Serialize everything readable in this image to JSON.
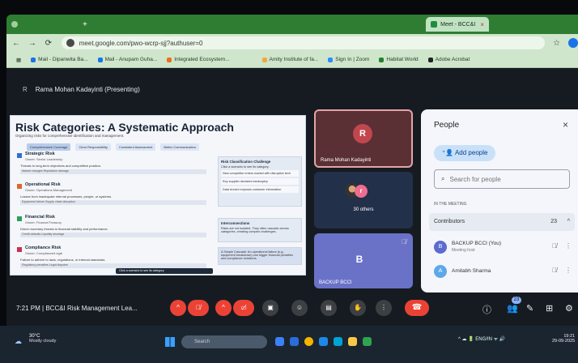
{
  "browser": {
    "tabs": [
      "",
      "",
      "",
      "",
      "",
      "Meet - BCC&I"
    ],
    "url": "meet.google.com/pwo-wcrp-sjj?authuser=0",
    "bookmarks": [
      "Mail - Dipanwita Ba...",
      "Mail - Anupam Guha...",
      "Integrated Ecosystem...",
      "",
      "Amity Institute of fa...",
      "Sign In | Zoom",
      "Habitat World",
      "Adobe Acrobat"
    ]
  },
  "meet": {
    "presenter_initial": "R",
    "presenter": "Rama Mohan Kadayinti (Presenting)",
    "time": "7:21 PM",
    "meeting_title": "BCC&I Risk Management Lea...",
    "slide": {
      "title": "Risk Categories: A Systematic Approach",
      "subtitle": "Organizing risks for comprehensive identification and management.",
      "tabs": [
        "Comprehensive Coverage",
        "Clear Responsibility",
        "Consistent Assessment",
        "Better Communication"
      ],
      "risks": [
        {
          "title": "Strategic Risk",
          "owner": "Owner: Senior Leadership",
          "desc": "Threats to long-term objectives and competitive position.",
          "bar": "Market changes   Reputation damage",
          "color": "#2f6fd0"
        },
        {
          "title": "Operational Risk",
          "owner": "Owner: Operations Management",
          "desc": "Losses from inadequate internal processes, people, or systems.",
          "bar": "Equipment failure   Supply chain disruption",
          "color": "#e0662a"
        },
        {
          "title": "Financial Risk",
          "owner": "Owner: Finance/Treasury",
          "desc": "Direct monetary threats to financial stability and performance.",
          "bar": "Credit defaults   Liquidity shortage",
          "color": "#2aa05a"
        },
        {
          "title": "Compliance Risk",
          "owner": "Owner: Compliance/Legal",
          "desc": "Failure to adhere to laws, regulations, or internal standards.",
          "bar": "Regulatory penalties   Legal disputes",
          "color": "#c83250"
        }
      ],
      "panel1": {
        "title": "Risk Classification Challenge",
        "lines": [
          "Click a scenario to see its category.",
          "New competitor enters market with disruptive tech",
          "Key supplier declares bankruptcy",
          "Data breach exposes customer information"
        ]
      },
      "panel2": {
        "title": "Interconnections",
        "lines": [
          "Risks are not isolated. They often cascade across categories, creating complex challenges."
        ]
      },
      "panel3": "A Simple Cascade: An operational failure (e.g., equipment breakdown) can trigger financial penalties and compliance violations.",
      "toast": "Click a scenario to see its category"
    },
    "tiles": [
      {
        "initial": "R",
        "name": "Rama Mohan Kadayinti"
      },
      {
        "initial": "r",
        "name": "30 others"
      },
      {
        "initial": "B",
        "name": "BACKUP BCCI"
      }
    ],
    "controls": [
      "^",
      "mic-off",
      "^",
      "cam-off",
      "present",
      "emoji",
      "captions",
      "hand",
      "more",
      "end"
    ],
    "people_count_badge": "23"
  },
  "people": {
    "title": "People",
    "add_label": "Add people",
    "search_placeholder": "Search for people",
    "in_meeting": "IN THE MEETING",
    "contributors_label": "Contributors",
    "contributors_count": "23",
    "participants": [
      {
        "initial": "B",
        "name": "BACKUP BCCI (You)",
        "sub": "Meeting host",
        "color": "#5b6bd0"
      },
      {
        "initial": "A",
        "name": "Amitabh Sharma",
        "sub": "",
        "color": "#5ea8e8"
      }
    ]
  },
  "taskbar": {
    "temp": "30°C",
    "weather": "Mostly cloudy",
    "search": "Search",
    "lang": "ENG",
    "region": "IN",
    "time": "19:21",
    "date": "29-09-2025"
  }
}
